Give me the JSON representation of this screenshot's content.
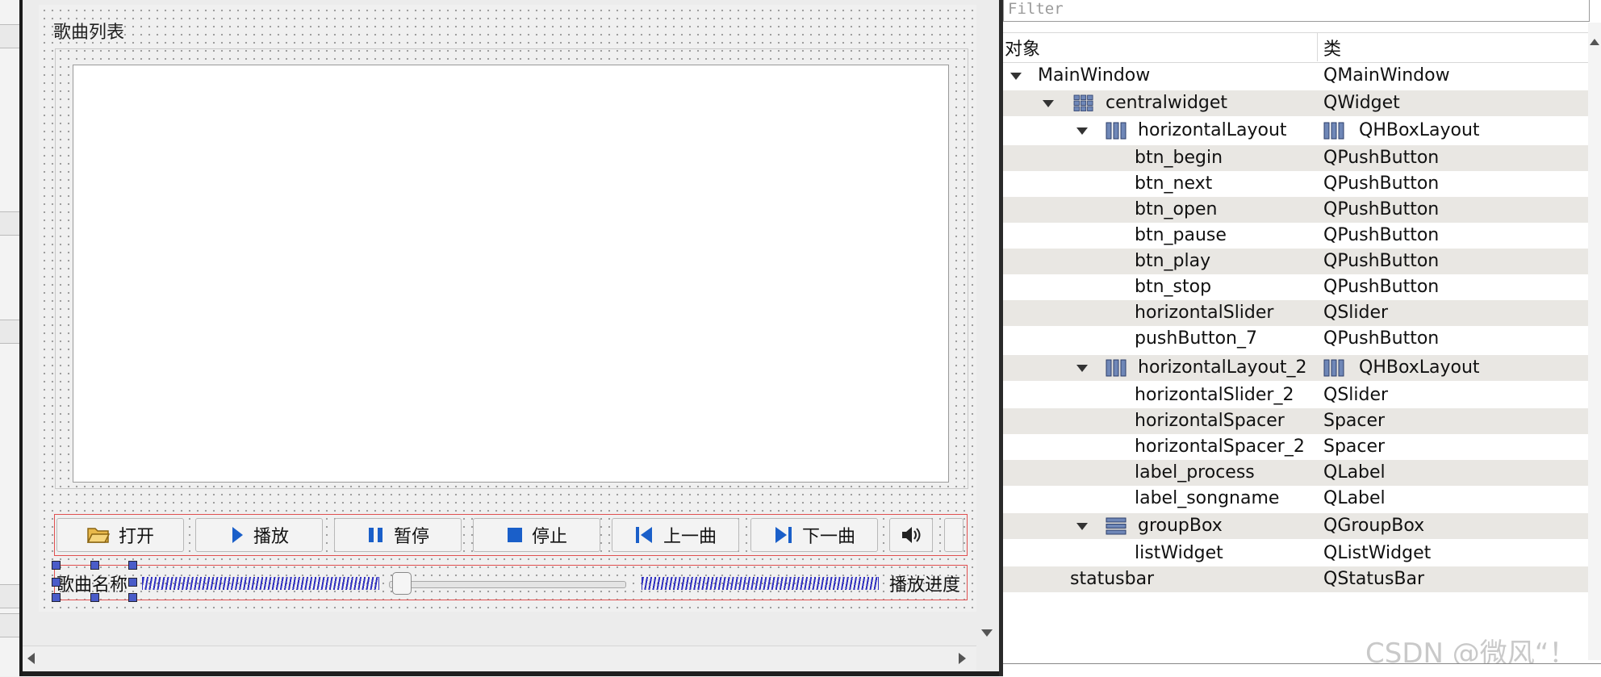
{
  "form": {
    "group_title": "歌曲列表",
    "buttons": [
      {
        "label": "打开",
        "icon": "folder-open-icon"
      },
      {
        "label": "播放",
        "icon": "play-icon"
      },
      {
        "label": "暂停",
        "icon": "pause-icon"
      },
      {
        "label": "停止",
        "icon": "stop-icon"
      },
      {
        "label": "上一曲",
        "icon": "previous-track-icon"
      },
      {
        "label": "下一曲",
        "icon": "next-track-icon"
      }
    ],
    "volume_icon": "speaker-icon",
    "label_songname": "歌曲名称",
    "label_process": "播放进度",
    "slider_value_fraction": 0.02
  },
  "inspector": {
    "filter_placeholder": "Filter",
    "col_object": "对象",
    "col_class": "类",
    "rows": [
      {
        "name": "MainWindow",
        "cls": "QMainWindow"
      },
      {
        "name": "centralwidget",
        "cls": "QWidget"
      },
      {
        "name": "horizontalLayout",
        "cls": "QHBoxLayout"
      },
      {
        "name": "btn_begin",
        "cls": "QPushButton"
      },
      {
        "name": "btn_next",
        "cls": "QPushButton"
      },
      {
        "name": "btn_open",
        "cls": "QPushButton"
      },
      {
        "name": "btn_pause",
        "cls": "QPushButton"
      },
      {
        "name": "btn_play",
        "cls": "QPushButton"
      },
      {
        "name": "btn_stop",
        "cls": "QPushButton"
      },
      {
        "name": "horizontalSlider",
        "cls": "QSlider"
      },
      {
        "name": "pushButton_7",
        "cls": "QPushButton"
      },
      {
        "name": "horizontalLayout_2",
        "cls": "QHBoxLayout"
      },
      {
        "name": "horizontalSlider_2",
        "cls": "QSlider"
      },
      {
        "name": "horizontalSpacer",
        "cls": "Spacer"
      },
      {
        "name": "horizontalSpacer_2",
        "cls": "Spacer"
      },
      {
        "name": "label_process",
        "cls": "QLabel"
      },
      {
        "name": "label_songname",
        "cls": "QLabel"
      },
      {
        "name": "groupBox",
        "cls": "QGroupBox"
      },
      {
        "name": "listWidget",
        "cls": "QListWidget"
      },
      {
        "name": "statusbar",
        "cls": "QStatusBar"
      }
    ]
  },
  "watermark": "CSDN @微风“！"
}
